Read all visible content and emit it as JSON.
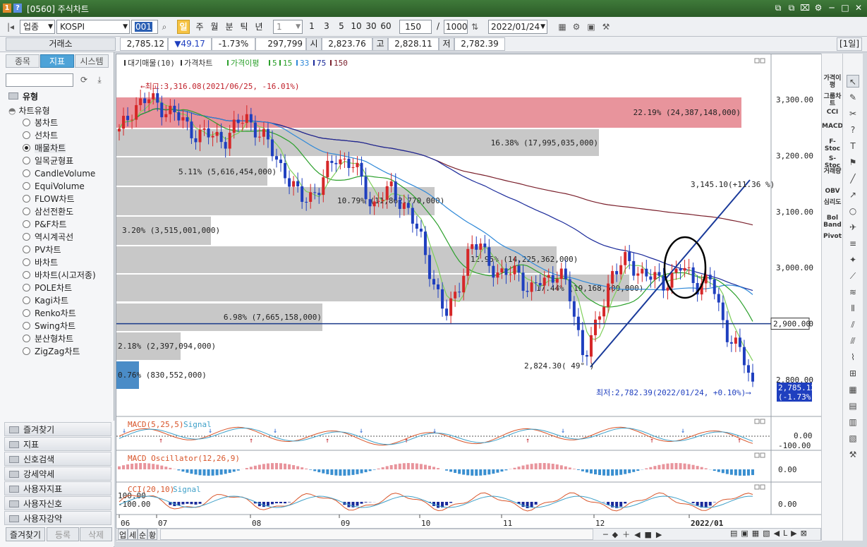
{
  "window": {
    "badge1": "1",
    "badge2": "?",
    "title": "[0560] 주식차트",
    "buttons": [
      "⧉",
      "⧉",
      "⌧",
      "⚙",
      "─",
      "□",
      "✕"
    ]
  },
  "toolbar": {
    "market": "업종",
    "index": "KOSPI",
    "code": "001",
    "periods": [
      "일",
      "주",
      "월",
      "분",
      "틱",
      "년"
    ],
    "minute_val": "1",
    "nums": [
      "1",
      "3",
      "5",
      "10",
      "30",
      "60"
    ],
    "count": "150",
    "total": "1000",
    "date": "2022/01/24"
  },
  "quote": {
    "exchange": "거래소",
    "price": "2,785.12",
    "change": "▼49.17",
    "rate": "-1.73%",
    "volume": "297,799",
    "open_label": "시",
    "open": "2,823.76",
    "high_label": "고",
    "high": "2,828.11",
    "low_label": "저",
    "low": "2,782.39",
    "period_badge": "[1일]"
  },
  "sidebar": {
    "tabs": [
      "종목",
      "지표",
      "시스템"
    ],
    "type_header": "유형",
    "tree_root": "차트유형",
    "chart_types": [
      "봉차트",
      "선차트",
      "매물차트",
      "일목균형표",
      "CandleVolume",
      "EquiVolume",
      "FLOW차트",
      "삼선전환도",
      "P&F차트",
      "역시계곡선",
      "PV차트",
      "바차트",
      "바차트(시고저종)",
      "POLE차트",
      "Kagi차트",
      "Renko차트",
      "Swing차트",
      "분산형차트",
      "ZigZag차트"
    ],
    "selected_index": 2,
    "sections": [
      "즐겨찾기",
      "지표",
      "신호검색",
      "강세약세",
      "사용자지표",
      "사용자신호",
      "사용자강약"
    ],
    "bottom_tabs": [
      "즐겨찾기",
      "등록",
      "삭제"
    ]
  },
  "chart": {
    "legend": [
      "대기매물(10)",
      "가격차트",
      "가격이평",
      "5",
      "15",
      "33",
      "75",
      "150"
    ],
    "colors": {
      "ma5": "#2ca02c",
      "ma15": "#2ca02c",
      "ma33": "#2e88d8",
      "ma75": "#1a2a9a",
      "ma150": "#7a1f2b",
      "up": "#d62728",
      "down": "#1f3fbf",
      "high_band": "#e8949c",
      "band": "#c8c8c8",
      "low_band": "#4a8cc7"
    },
    "yticks": [
      "3,300.00",
      "3,200.00",
      "3,100.00",
      "3,000.00",
      "2,900.00",
      "2,800.00"
    ],
    "xticks": [
      "06",
      "07",
      "08",
      "09",
      "10",
      "11",
      "12",
      "2022/01"
    ],
    "high_note": "←최고:3,316.08(2021/06/25, -16.01%)",
    "low_note": "최저:2,782.39(2022/01/24, +0.10%)⟶",
    "trend_start": "2,824.30( 49° )",
    "trend_end": "3,145.10(+11.36 %)",
    "hline_label": "2,900.00",
    "last_price": "2,785.12",
    "last_rate": "(-1.73%)",
    "bands": [
      {
        "label": "22.19% (24,387,148,000)"
      },
      {
        "label": "16.38% (17,995,035,000)"
      },
      {
        "label": "5.11% (5,616,454,000)"
      },
      {
        "label": "10.79% (11,862,770,000)"
      },
      {
        "label": "3.20% (3,515,001,000)"
      },
      {
        "label": "12.95% (14,225,362,000)"
      },
      {
        "label": "17.44% (19,168,500,000)"
      },
      {
        "label": "6.98% (7,665,158,000)"
      },
      {
        "label": "2.18% (2,397,094,000)"
      },
      {
        "label": "0.76% (830,552,000)"
      }
    ],
    "macd": {
      "title": "MACD(5,25,5)",
      "signal": "Signal",
      "ticks": [
        "0.00",
        "-100.00"
      ]
    },
    "osc": {
      "title": "MACD Oscillator(12,26,9)",
      "ticks": [
        "0.00"
      ]
    },
    "cci": {
      "title": "CCI(20,10)",
      "signal": "Signal",
      "ticks": [
        "100.00",
        "-100.00",
        "0.00"
      ]
    }
  },
  "bottombar": {
    "tabs": [
      "업",
      "세",
      "순",
      "황"
    ]
  },
  "right_tools": [
    "가격이평",
    "그룹차트",
    "CCI",
    "MACD",
    "F-Stoc",
    "S-Stoc",
    "거래량",
    "OBV",
    "심리도",
    "Bol Band",
    "Pivot"
  ]
}
